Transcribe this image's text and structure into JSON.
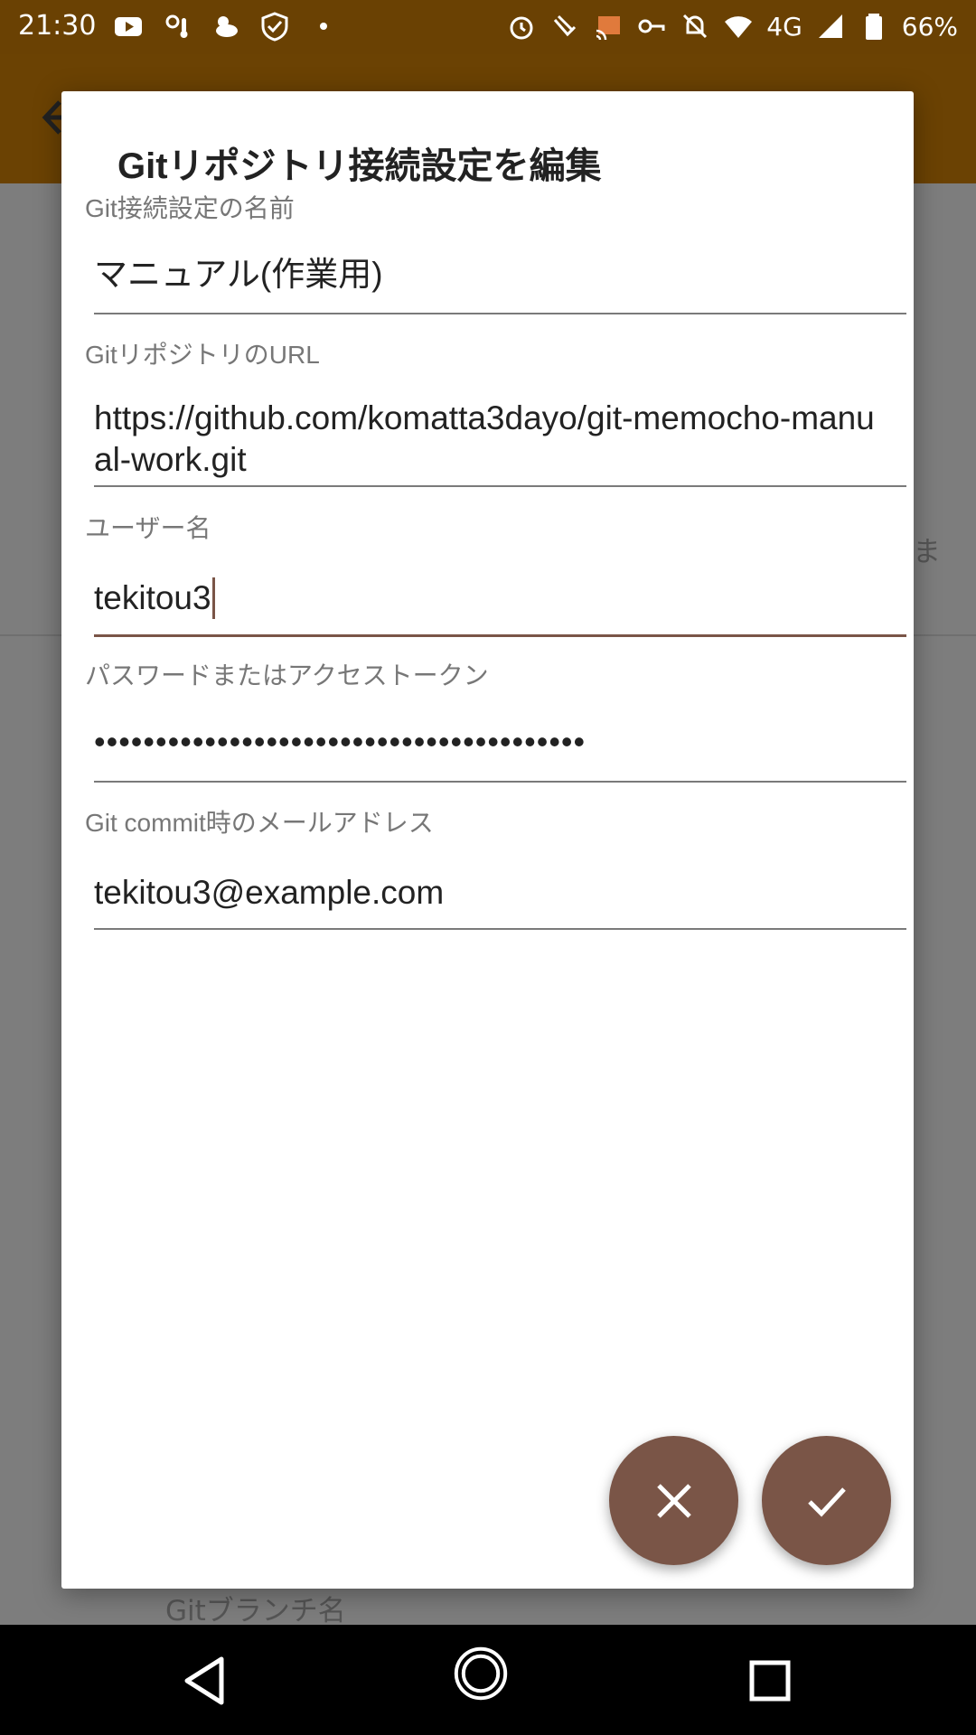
{
  "status_bar": {
    "time": "21:30",
    "network": "4G",
    "battery": "66%"
  },
  "background": {
    "partial_text_right": "ま",
    "branch_label": "Gitブランチ名"
  },
  "dialog": {
    "title": "Gitリポジトリ接続設定を編集",
    "fields": [
      {
        "label": "Git接続設定の名前",
        "value": "マニュアル(作業用)"
      },
      {
        "label": "GitリポジトリのURL",
        "value": "https://github.com/komatta3dayo/git-memocho-manual-work.git"
      },
      {
        "label": "ユーザー名",
        "value": "tekitou3"
      },
      {
        "label": "パスワードまたはアクセストークン",
        "value": "••••••••••••••••••••••••••••••••••••••••"
      },
      {
        "label": "Git commit時のメールアドレス",
        "value": "tekitou3@example.com"
      }
    ]
  },
  "colors": {
    "accent": "#7a5547",
    "app_bar": "#6b4203",
    "status_bar": "#6a4103"
  }
}
